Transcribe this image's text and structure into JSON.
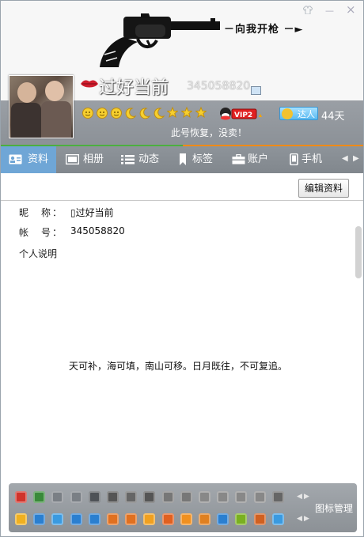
{
  "window": {
    "skin_icon": "shirt-icon",
    "minimize": "—",
    "close": "×"
  },
  "banner": {
    "slogan": "－向我开枪 －►",
    "background_image": "revolver-illustration"
  },
  "profile": {
    "nickname": "过好当前",
    "qq_number": "345058820",
    "level_icons": [
      "sun",
      "sun",
      "sun",
      "moon",
      "moon",
      "moon",
      "star",
      "star",
      "star"
    ],
    "vip_label": "VIP2",
    "daren_label": "达人",
    "days": "44天",
    "signature": "此号恢复，没卖！"
  },
  "tabs": [
    {
      "label": "资料",
      "icon": "id-card-icon",
      "active": true
    },
    {
      "label": "相册",
      "icon": "photo-icon",
      "active": false
    },
    {
      "label": "动态",
      "icon": "list-icon",
      "active": false
    },
    {
      "label": "标签",
      "icon": "bookmark-icon",
      "active": false
    },
    {
      "label": "账户",
      "icon": "briefcase-icon",
      "active": false
    },
    {
      "label": "手机",
      "icon": "phone-icon",
      "active": false
    }
  ],
  "actions": {
    "edit_profile": "编辑资料"
  },
  "info": {
    "nickname_label": "昵　称：",
    "nickname_value": "▯过好当前",
    "account_label": "帐　号：",
    "account_value": "345058820",
    "bio_label": "个人说明"
  },
  "bio_text": "天可补，海可填，南山可移。日月既往，不可复追。",
  "iconbar": {
    "manage_label": "图标管理",
    "colors": {
      "row1": [
        "#d0342c",
        "#3a8a3a",
        "#7a7f85",
        "#7a7f85",
        "#4e5257",
        "#555",
        "#666",
        "#555",
        "#777",
        "#777",
        "#888",
        "#888",
        "#888",
        "#888",
        "#666"
      ],
      "row2": [
        "#f0b020",
        "#2a7fd0",
        "#3a9ae0",
        "#2a7fd0",
        "#2a7fd0",
        "#e07020",
        "#e07020",
        "#f0a020",
        "#e06020",
        "#f09020",
        "#e08020",
        "#2a7fd0",
        "#7ab020",
        "#d06020",
        "#3a9ae0"
      ]
    }
  }
}
